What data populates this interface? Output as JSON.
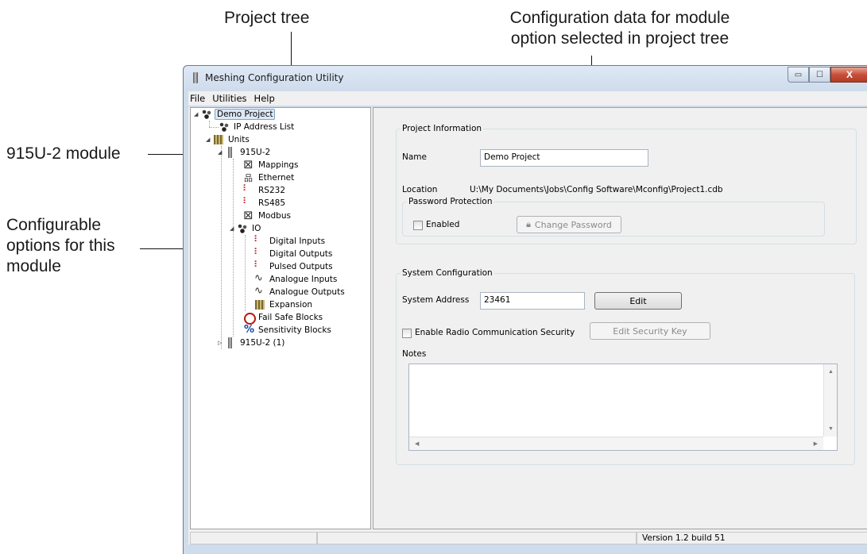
{
  "callouts": {
    "project_tree": "Project tree",
    "config_data_line1": "Configuration data for module",
    "config_data_line2": "option selected in project tree",
    "module": "915U-2 module",
    "options_line1": "Configurable",
    "options_line2": "options for this",
    "options_line3": "module"
  },
  "window": {
    "title": "Meshing Configuration Utility",
    "controls": {
      "minimize": "▭",
      "maximize": "☐",
      "close": "X"
    }
  },
  "menu": [
    "File",
    "Utilities",
    "Help"
  ],
  "tree": {
    "root": "Demo Project",
    "ip_list": "IP Address List",
    "units": "Units",
    "module": "915U-2",
    "mappings": "Mappings",
    "ethernet": "Ethernet",
    "rs232": "RS232",
    "rs485": "RS485",
    "modbus": "Modbus",
    "io": "IO",
    "digital_inputs": "Digital Inputs",
    "digital_outputs": "Digital Outputs",
    "pulsed_outputs": "Pulsed Outputs",
    "analogue_inputs": "Analogue Inputs",
    "analogue_outputs": "Analogue Outputs",
    "expansion": "Expansion",
    "fail_safe": "Fail Safe Blocks",
    "sensitivity": "Sensitivity Blocks",
    "module2": "915U-2 (1)"
  },
  "project_info": {
    "legend": "Project Information",
    "name_label": "Name",
    "name_value": "Demo Project",
    "location_label": "Location",
    "location_value": "U:\\My Documents\\Jobs\\Config Software\\Mconfig\\Project1.cdb",
    "password_legend": "Password Protection",
    "enabled_label": "Enabled",
    "change_password": "Change Password"
  },
  "system_config": {
    "legend": "System Configuration",
    "address_label": "System Address",
    "address_value": "23461",
    "edit_button": "Edit",
    "security_label": "Enable Radio Communication Security",
    "edit_key_button": "Edit Security Key",
    "notes_label": "Notes",
    "notes_value": ""
  },
  "status": {
    "version": "Version 1.2 build 51"
  },
  "colors": {
    "selection_bg": "#dce8f6",
    "serial_icon": "#c21a1a",
    "failsafe_icon": "#b4160c",
    "sensitivity_icon": "#1746a8"
  }
}
